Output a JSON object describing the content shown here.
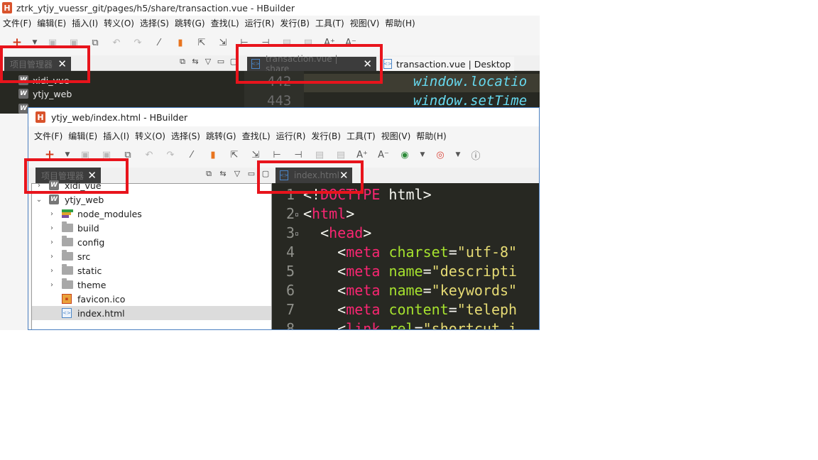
{
  "back_window": {
    "title": "ztrk_ytjy_vuessr_git/pages/h5/share/transaction.vue  -  HBuilder",
    "logo": "H",
    "menu": [
      "文件(F)",
      "编辑(E)",
      "插入(I)",
      "转义(O)",
      "选择(S)",
      "跳转(G)",
      "查找(L)",
      "运行(R)",
      "发行(B)",
      "工具(T)",
      "视图(V)",
      "帮助(H)"
    ],
    "project_tab": {
      "label": "项目管理器",
      "close": "✕"
    },
    "tree": [
      {
        "name": "xidi_vue"
      },
      {
        "name": "ytjy_web"
      }
    ],
    "editor_tabs": [
      {
        "label": "transaction.vue | share",
        "close": "✕",
        "active": true
      },
      {
        "label": "transaction.vue | Desktop",
        "active": false
      }
    ],
    "code": [
      {
        "line": "442",
        "text": "window.locatio"
      },
      {
        "line": "443",
        "text": "window.setTime"
      }
    ]
  },
  "front_window": {
    "title": "ytjy_web/index.html  -  HBuilder",
    "logo": "H",
    "menu": [
      "文件(F)",
      "编辑(E)",
      "插入(I)",
      "转义(O)",
      "选择(S)",
      "跳转(G)",
      "查找(L)",
      "运行(R)",
      "发行(B)",
      "工具(T)",
      "视图(V)",
      "帮助(H)"
    ],
    "project_tab": {
      "label": "项目管理器",
      "close": "✕"
    },
    "tree": [
      {
        "name": "xidi_vue",
        "type": "project",
        "indent": 0,
        "expanded": false
      },
      {
        "name": "ytjy_web",
        "type": "project",
        "indent": 0,
        "expanded": true
      },
      {
        "name": "node_modules",
        "type": "folder-npm",
        "indent": 1
      },
      {
        "name": "build",
        "type": "folder",
        "indent": 1
      },
      {
        "name": "config",
        "type": "folder",
        "indent": 1
      },
      {
        "name": "src",
        "type": "folder",
        "indent": 1
      },
      {
        "name": "static",
        "type": "folder",
        "indent": 1
      },
      {
        "name": "theme",
        "type": "folder",
        "indent": 1
      },
      {
        "name": "favicon.ico",
        "type": "file-ico",
        "indent": 1
      },
      {
        "name": "index.html",
        "type": "file-html",
        "indent": 1,
        "selected": true
      }
    ],
    "editor_tab": {
      "label": "index.html",
      "close": "✕"
    },
    "code": [
      {
        "n": "1",
        "fold": "",
        "parts": [
          {
            "c": "pu",
            "t": "<!"
          },
          {
            "c": "tg",
            "t": "DOCTYPE"
          },
          {
            "c": "pu",
            "t": " html>"
          }
        ]
      },
      {
        "n": "2",
        "fold": "▫",
        "parts": [
          {
            "c": "pu",
            "t": "<"
          },
          {
            "c": "tg",
            "t": "html"
          },
          {
            "c": "pu",
            "t": ">"
          }
        ]
      },
      {
        "n": "3",
        "fold": "▫",
        "parts": [
          {
            "c": "pu",
            "t": "  <"
          },
          {
            "c": "tg",
            "t": "head"
          },
          {
            "c": "pu",
            "t": ">"
          }
        ]
      },
      {
        "n": "4",
        "fold": "",
        "parts": [
          {
            "c": "pu",
            "t": "    <"
          },
          {
            "c": "tg",
            "t": "meta"
          },
          {
            "c": "pu",
            "t": " "
          },
          {
            "c": "at",
            "t": "charset"
          },
          {
            "c": "pu",
            "t": "="
          },
          {
            "c": "st",
            "t": "\"utf-8\""
          }
        ]
      },
      {
        "n": "5",
        "fold": "",
        "parts": [
          {
            "c": "pu",
            "t": "    <"
          },
          {
            "c": "tg",
            "t": "meta"
          },
          {
            "c": "pu",
            "t": " "
          },
          {
            "c": "at",
            "t": "name"
          },
          {
            "c": "pu",
            "t": "="
          },
          {
            "c": "st",
            "t": "\"descripti"
          }
        ]
      },
      {
        "n": "6",
        "fold": "",
        "parts": [
          {
            "c": "pu",
            "t": "    <"
          },
          {
            "c": "tg",
            "t": "meta"
          },
          {
            "c": "pu",
            "t": " "
          },
          {
            "c": "at",
            "t": "name"
          },
          {
            "c": "pu",
            "t": "="
          },
          {
            "c": "st",
            "t": "\"keywords\""
          }
        ]
      },
      {
        "n": "7",
        "fold": "",
        "parts": [
          {
            "c": "pu",
            "t": "    <"
          },
          {
            "c": "tg",
            "t": "meta"
          },
          {
            "c": "pu",
            "t": " "
          },
          {
            "c": "at",
            "t": "content"
          },
          {
            "c": "pu",
            "t": "="
          },
          {
            "c": "st",
            "t": "\"teleph"
          }
        ]
      },
      {
        "n": "8",
        "fold": "",
        "parts": [
          {
            "c": "pu",
            "t": "    <"
          },
          {
            "c": "tg",
            "t": "link"
          },
          {
            "c": "pu",
            "t": " "
          },
          {
            "c": "at",
            "t": "rel"
          },
          {
            "c": "pu",
            "t": "="
          },
          {
            "c": "st",
            "t": "\"shortcut i"
          }
        ]
      }
    ]
  },
  "colors": {
    "editor_bg": "#272822",
    "highlight_box": "#e8141c",
    "window_border": "#4a7fc0",
    "logo": "#d9532c"
  }
}
